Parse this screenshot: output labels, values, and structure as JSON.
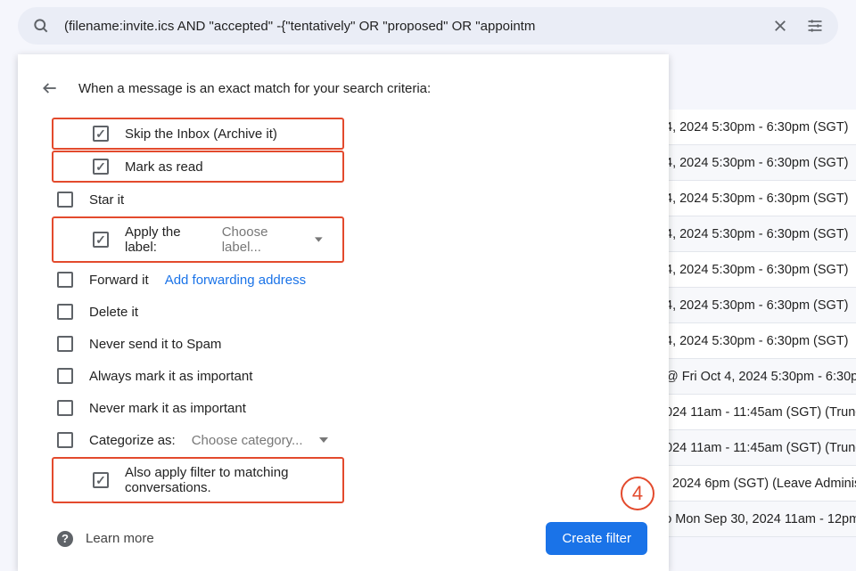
{
  "search": {
    "query": "(filename:invite.ics AND \"accepted\" -{\"tentatively\" OR \"proposed\" OR \"appointm"
  },
  "panel": {
    "header": "When a message is an exact match for your search criteria:",
    "options": {
      "skip_inbox": "Skip the Inbox (Archive it)",
      "mark_read": "Mark as read",
      "star_it": "Star it",
      "apply_label": "Apply the label:",
      "apply_label_choose": "Choose label...",
      "forward_it": "Forward it",
      "forward_link": "Add forwarding address",
      "delete_it": "Delete it",
      "never_spam": "Never send it to Spam",
      "always_important": "Always mark it as important",
      "never_important": "Never mark it as important",
      "categorize": "Categorize as:",
      "categorize_choose": "Choose category...",
      "also_apply": "Also apply filter to matching conversations."
    },
    "learn_more": "Learn more",
    "create_filter": "Create filter",
    "step_number": "4"
  },
  "bg_rows": [
    "4, 2024 5:30pm - 6:30pm (SGT)",
    "4, 2024 5:30pm - 6:30pm (SGT)",
    "4, 2024 5:30pm - 6:30pm (SGT)",
    "4, 2024 5:30pm - 6:30pm (SGT)",
    "4, 2024 5:30pm - 6:30pm (SGT)",
    "4, 2024 5:30pm - 6:30pm (SGT)",
    "4, 2024 5:30pm - 6:30pm (SGT)",
    "@ Fri Oct 4, 2024 5:30pm - 6:30p",
    "024 11am - 11:45am (SGT) (Trung",
    "024 11am - 11:45am (SGT) (Trung",
    ", 2024 6pm (SGT) (Leave Adminis",
    "ɔ Mon Sep 30, 2024 11am - 12pm"
  ]
}
